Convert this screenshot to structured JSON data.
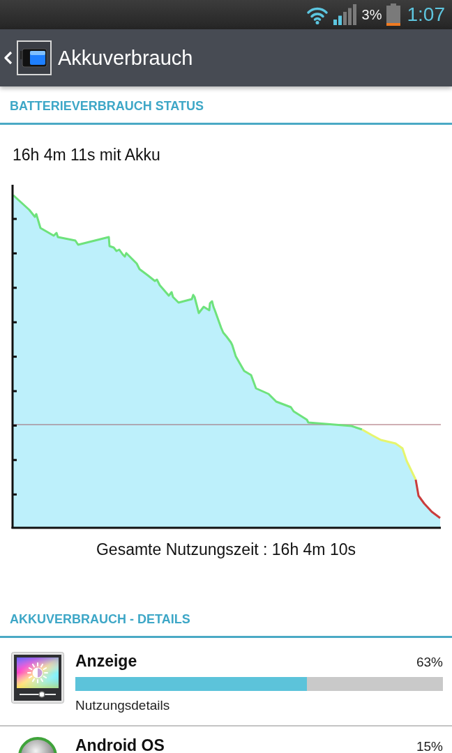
{
  "status_bar": {
    "battery_percent": "3%",
    "time": "1:07"
  },
  "action_bar": {
    "title": "Akkuverbrauch"
  },
  "status_section": {
    "header": "BATTERIEVERBRAUCH STATUS",
    "on_battery": "16h 4m 11s mit Akku",
    "total_usage": "Gesamte Nutzungszeit : 16h 4m 10s"
  },
  "details_section": {
    "header": "AKKUVERBRAUCH - DETAILS",
    "items": [
      {
        "kind": "display",
        "name": "Anzeige",
        "percent": "63%",
        "level": 0.63,
        "subtitle": "Nutzungsdetails"
      },
      {
        "kind": "system",
        "name": "Android OS",
        "percent": "15%"
      }
    ]
  }
}
